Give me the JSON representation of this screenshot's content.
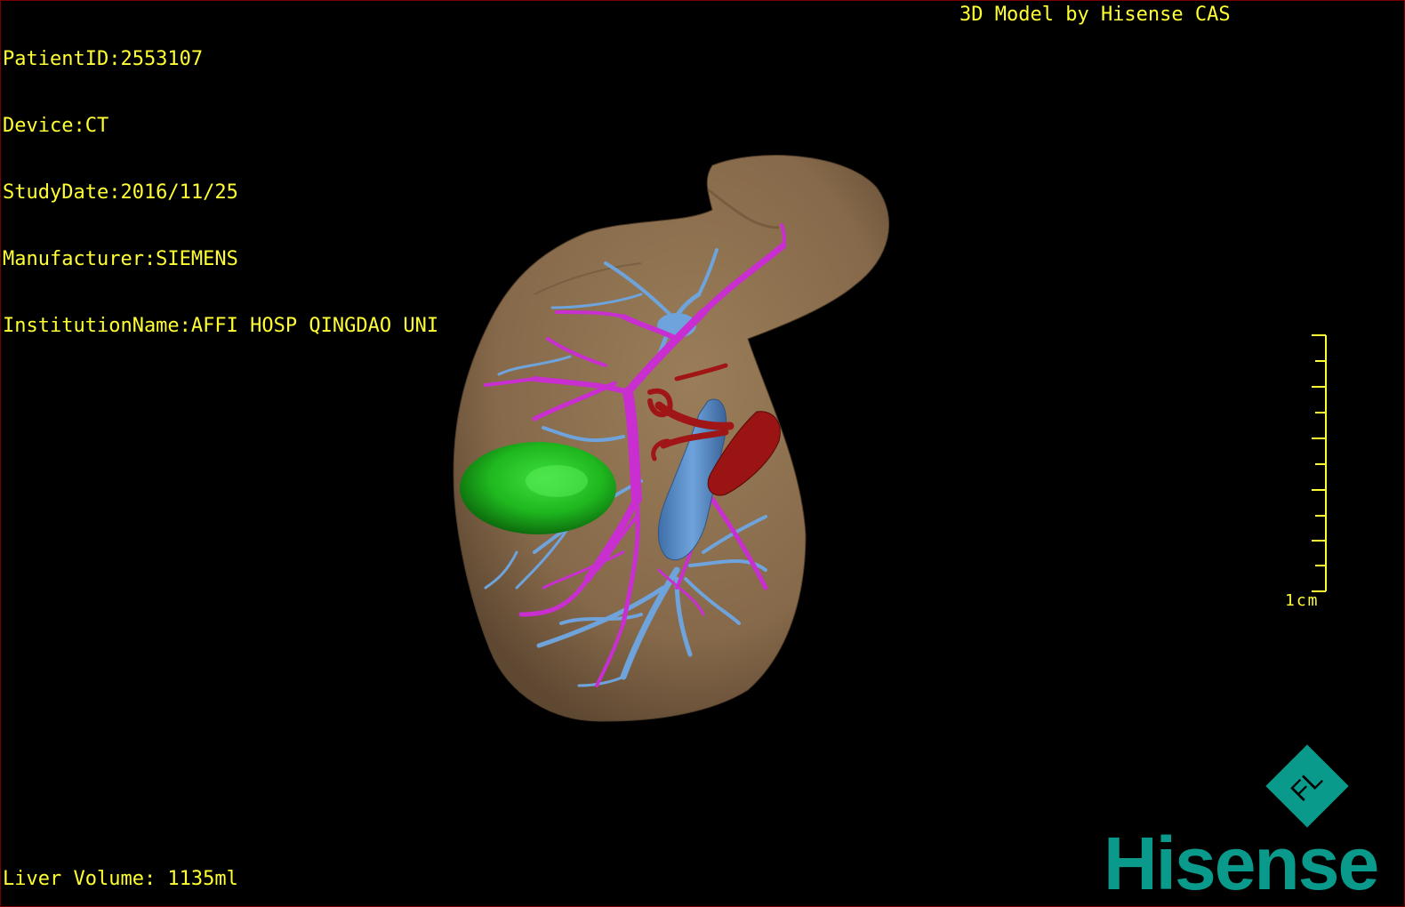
{
  "header": {
    "patient_id": "PatientID:2553107",
    "device": "Device:CT",
    "study_date": "StudyDate:2016/11/25",
    "manufacturer": "Manufacturer:SIEMENS",
    "institution": "InstitutionName:AFFI HOSP QINGDAO UNI"
  },
  "credit": "3D Model by Hisense CAS",
  "footer": {
    "liver_volume": "Liver Volume: 1135ml"
  },
  "scale_bar": {
    "label": "1cm"
  },
  "logo": {
    "word": "Hisense",
    "mark_letters": "FL",
    "color": "#0a9a8c"
  },
  "colors": {
    "overlay_text": "#ffff33",
    "liver": "#8a6f4e",
    "portal_vein": "#c82ed0",
    "hepatic_vein": "#6fa3dc",
    "artery": "#a01515",
    "lesion": "#1fb81f"
  }
}
